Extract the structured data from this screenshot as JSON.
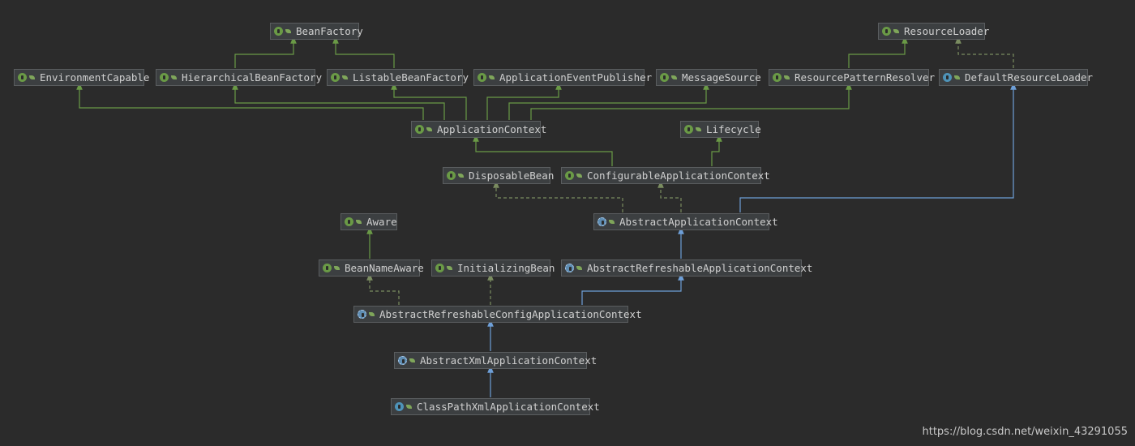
{
  "colors": {
    "background": "#2b2b2b",
    "node_fill": "#3c3f41",
    "node_border": "#5a5d5f",
    "extends_interface": "#6a9a46",
    "extends_class": "#6e9fd8",
    "implements": "#7a8c60"
  },
  "icons": {
    "interface": "interface-icon",
    "abstract": "abstract-class-icon",
    "class": "class-icon"
  },
  "nodes": {
    "BeanFactory": {
      "label": "BeanFactory",
      "kind": "interface"
    },
    "ResourceLoader": {
      "label": "ResourceLoader",
      "kind": "interface"
    },
    "EnvironmentCapable": {
      "label": "EnvironmentCapable",
      "kind": "interface"
    },
    "HierarchicalBeanFactory": {
      "label": "HierarchicalBeanFactory",
      "kind": "interface"
    },
    "ListableBeanFactory": {
      "label": "ListableBeanFactory",
      "kind": "interface"
    },
    "ApplicationEventPublisher": {
      "label": "ApplicationEventPublisher",
      "kind": "interface"
    },
    "MessageSource": {
      "label": "MessageSource",
      "kind": "interface"
    },
    "ResourcePatternResolver": {
      "label": "ResourcePatternResolver",
      "kind": "interface"
    },
    "DefaultResourceLoader": {
      "label": "DefaultResourceLoader",
      "kind": "class"
    },
    "ApplicationContext": {
      "label": "ApplicationContext",
      "kind": "interface"
    },
    "Lifecycle": {
      "label": "Lifecycle",
      "kind": "interface"
    },
    "DisposableBean": {
      "label": "DisposableBean",
      "kind": "interface"
    },
    "ConfigurableApplicationContext": {
      "label": "ConfigurableApplicationContext",
      "kind": "interface"
    },
    "Aware": {
      "label": "Aware",
      "kind": "interface"
    },
    "AbstractApplicationContext": {
      "label": "AbstractApplicationContext",
      "kind": "abstract"
    },
    "BeanNameAware": {
      "label": "BeanNameAware",
      "kind": "interface"
    },
    "InitializingBean": {
      "label": "InitializingBean",
      "kind": "interface"
    },
    "AbstractRefreshableApplicationContext": {
      "label": "AbstractRefreshableApplicationContext",
      "kind": "abstract"
    },
    "AbstractRefreshableConfigApplicationContext": {
      "label": "AbstractRefreshableConfigApplicationContext",
      "kind": "abstract"
    },
    "AbstractXmlApplicationContext": {
      "label": "AbstractXmlApplicationContext",
      "kind": "abstract"
    },
    "ClassPathXmlApplicationContext": {
      "label": "ClassPathXmlApplicationContext",
      "kind": "class"
    }
  },
  "edges": [
    {
      "from": "HierarchicalBeanFactory",
      "to": "BeanFactory",
      "type": "extends-interface"
    },
    {
      "from": "ListableBeanFactory",
      "to": "BeanFactory",
      "type": "extends-interface"
    },
    {
      "from": "ResourcePatternResolver",
      "to": "ResourceLoader",
      "type": "extends-interface"
    },
    {
      "from": "DefaultResourceLoader",
      "to": "ResourceLoader",
      "type": "implements"
    },
    {
      "from": "ApplicationContext",
      "to": "EnvironmentCapable",
      "type": "extends-interface"
    },
    {
      "from": "ApplicationContext",
      "to": "HierarchicalBeanFactory",
      "type": "extends-interface"
    },
    {
      "from": "ApplicationContext",
      "to": "ListableBeanFactory",
      "type": "extends-interface"
    },
    {
      "from": "ApplicationContext",
      "to": "ApplicationEventPublisher",
      "type": "extends-interface"
    },
    {
      "from": "ApplicationContext",
      "to": "MessageSource",
      "type": "extends-interface"
    },
    {
      "from": "ApplicationContext",
      "to": "ResourcePatternResolver",
      "type": "extends-interface"
    },
    {
      "from": "ConfigurableApplicationContext",
      "to": "ApplicationContext",
      "type": "extends-interface"
    },
    {
      "from": "ConfigurableApplicationContext",
      "to": "Lifecycle",
      "type": "extends-interface"
    },
    {
      "from": "AbstractApplicationContext",
      "to": "DisposableBean",
      "type": "implements"
    },
    {
      "from": "AbstractApplicationContext",
      "to": "ConfigurableApplicationContext",
      "type": "implements"
    },
    {
      "from": "AbstractApplicationContext",
      "to": "DefaultResourceLoader",
      "type": "extends-class"
    },
    {
      "from": "BeanNameAware",
      "to": "Aware",
      "type": "extends-interface"
    },
    {
      "from": "AbstractRefreshableApplicationContext",
      "to": "AbstractApplicationContext",
      "type": "extends-class"
    },
    {
      "from": "AbstractRefreshableConfigApplicationContext",
      "to": "BeanNameAware",
      "type": "implements"
    },
    {
      "from": "AbstractRefreshableConfigApplicationContext",
      "to": "InitializingBean",
      "type": "implements"
    },
    {
      "from": "AbstractRefreshableConfigApplicationContext",
      "to": "AbstractRefreshableApplicationContext",
      "type": "extends-class"
    },
    {
      "from": "AbstractXmlApplicationContext",
      "to": "AbstractRefreshableConfigApplicationContext",
      "type": "extends-class"
    },
    {
      "from": "ClassPathXmlApplicationContext",
      "to": "AbstractXmlApplicationContext",
      "type": "extends-class"
    }
  ],
  "watermark": "https://blog.csdn.net/weixin_43291055"
}
